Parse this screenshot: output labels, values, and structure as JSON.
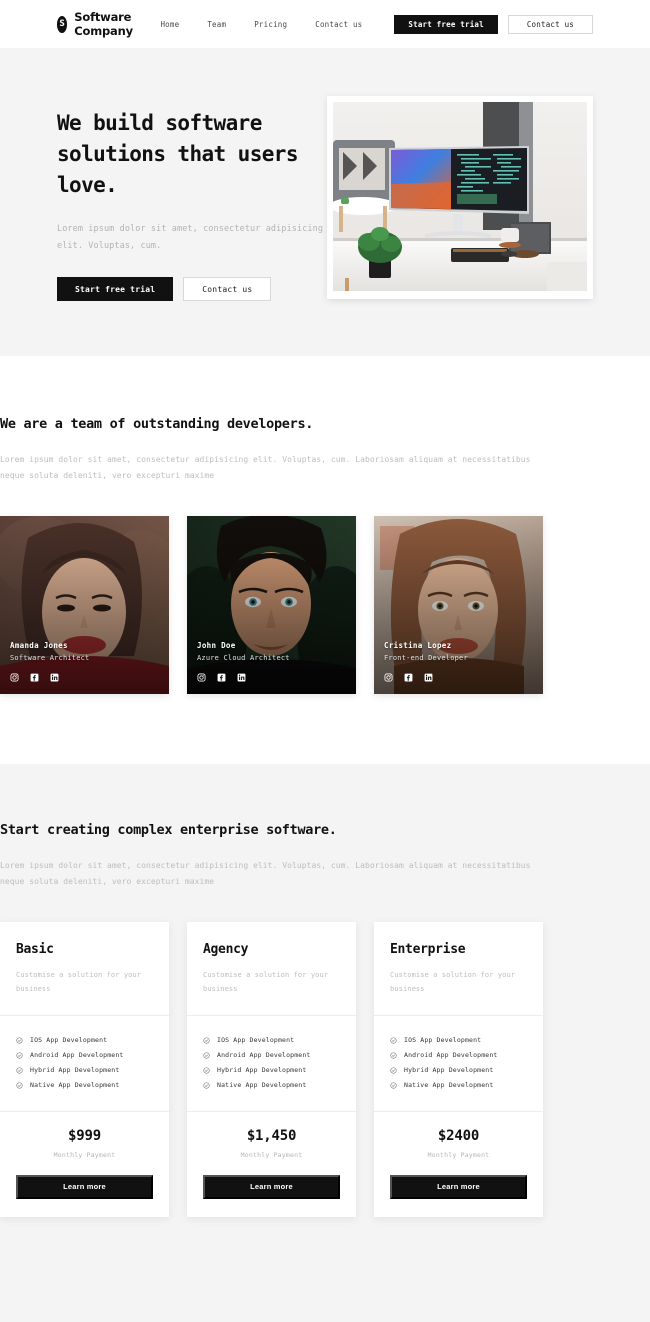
{
  "header": {
    "logo_letter": "S",
    "brand_name": "Software Company",
    "nav_links": [
      {
        "label": "Home"
      },
      {
        "label": "Team"
      },
      {
        "label": "Pricing"
      },
      {
        "label": "Contact us"
      }
    ],
    "primary_cta": "Start free trial",
    "secondary_cta": "Contact us"
  },
  "hero": {
    "title": "We build software solutions that users love.",
    "subtitle": "Lorem ipsum dolor sit amet, consectetur adipisicing elit. Voluptas, cum.",
    "primary_cta": "Start free trial",
    "secondary_cta": "Contact us",
    "image_alt": "desk-workspace-ultrawide-monitor-photo"
  },
  "team": {
    "heading": "We are a team of outstanding developers.",
    "description": "Lorem ipsum dolor sit amet, consectetur adipisicing elit. Voluptas, cum. Laboriosam aliquam at necessitatibus neque soluta deleniti, vero excepturi maxime",
    "members": [
      {
        "name": "Amanda Jones",
        "role": "Software Architect",
        "socials": [
          "instagram-icon",
          "facebook-icon",
          "linkedin-icon"
        ]
      },
      {
        "name": "John Doe",
        "role": "Azure Cloud Architect",
        "socials": [
          "instagram-icon",
          "facebook-icon",
          "linkedin-icon"
        ]
      },
      {
        "name": "Cristina Lopez",
        "role": "Front-end Developer",
        "socials": [
          "instagram-icon",
          "facebook-icon",
          "linkedin-icon"
        ]
      }
    ]
  },
  "pricing": {
    "heading": "Start creating complex enterprise software.",
    "description": "Lorem ipsum dolor sit amet, consectetur adipisicing elit. Voluptas, cum. Laboriosam aliquam at necessitatibus neque soluta deleniti, vero excepturi maxime",
    "plans": [
      {
        "title": "Basic",
        "description": "Customise a solution for your business",
        "features": [
          "IOS App Development",
          "Android App Development",
          "Hybrid App Development",
          "Native App Development"
        ],
        "price": "$999",
        "period": "Monthly Payment",
        "cta": "Learn more"
      },
      {
        "title": "Agency",
        "description": "Customise a solution for your business",
        "features": [
          "IOS App Development",
          "Android App Development",
          "Hybrid App Development",
          "Native App Development"
        ],
        "price": "$1,450",
        "period": "Monthly Payment",
        "cta": "Learn more"
      },
      {
        "title": "Enterprise",
        "description": "Customise a solution for your business",
        "features": [
          "IOS App Development",
          "Android App Development",
          "Hybrid App Development",
          "Native App Development"
        ],
        "price": "$2400",
        "period": "Monthly Payment",
        "cta": "Learn more"
      }
    ]
  },
  "colors": {
    "dark": "#111111",
    "page_gray": "#f4f4f4",
    "white": "#ffffff",
    "muted_text": "#bdbdbd",
    "border": "#d8d8d8"
  }
}
